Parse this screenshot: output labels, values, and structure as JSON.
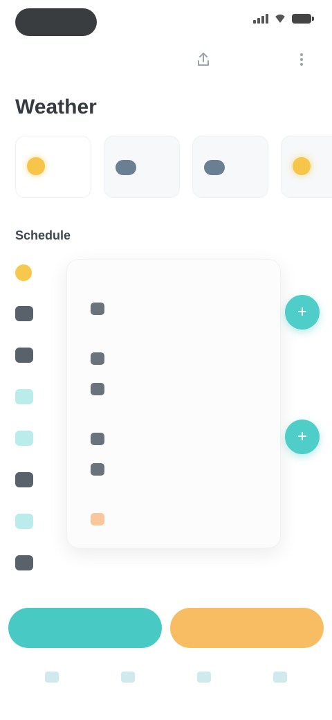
{
  "status_bar": {
    "time": "",
    "icons": [
      "signal-icon",
      "wifi-icon",
      "battery-icon"
    ]
  },
  "header": {
    "icons": [
      "share-icon",
      "more-icon"
    ]
  },
  "page": {
    "title": "Weather"
  },
  "days": [
    {
      "label": "",
      "temp": "",
      "sub": "",
      "weather": "sun"
    },
    {
      "label": "",
      "temp": "",
      "sub": "",
      "weather": "cloud"
    },
    {
      "label": "",
      "temp": "",
      "sub": "",
      "weather": "cloud"
    },
    {
      "label": "",
      "temp": "",
      "sub": "",
      "weather": "sun"
    }
  ],
  "section": {
    "title": "Schedule"
  },
  "schedule_rows": [
    {
      "icon": "sun",
      "time": "",
      "end": ""
    },
    {
      "icon": "dark",
      "time": "",
      "end": ""
    },
    {
      "icon": "dark",
      "time": "",
      "end": ""
    },
    {
      "icon": "teal",
      "time": "",
      "end": ""
    },
    {
      "icon": "teal",
      "time": "",
      "end": ""
    },
    {
      "icon": "dark",
      "time": "",
      "end": ""
    },
    {
      "icon": "teal",
      "time": "",
      "end": ""
    },
    {
      "icon": "dark",
      "time": "",
      "end": ""
    }
  ],
  "popup": {
    "header": "",
    "items": [
      {
        "label": "",
        "accent": false
      },
      {
        "label": "",
        "accent": false
      },
      {
        "label": "",
        "accent": false
      },
      {
        "label": "",
        "accent": false
      },
      {
        "label": "",
        "accent": false
      },
      {
        "label": "",
        "accent": true
      }
    ]
  },
  "fab_icons": [
    "add-icon",
    "add-icon"
  ],
  "actions": {
    "primary_label": "",
    "secondary_label": ""
  },
  "nav": [
    {
      "label": "",
      "icon": "home-icon"
    },
    {
      "label": "",
      "icon": "calendar-icon"
    },
    {
      "label": "",
      "icon": "chart-icon"
    },
    {
      "label": "",
      "icon": "profile-icon"
    }
  ],
  "colors": {
    "teal": "#49c9c3",
    "orange": "#f8bd63",
    "sun": "#f6c54a",
    "dark_pill": "#3a3d40"
  }
}
